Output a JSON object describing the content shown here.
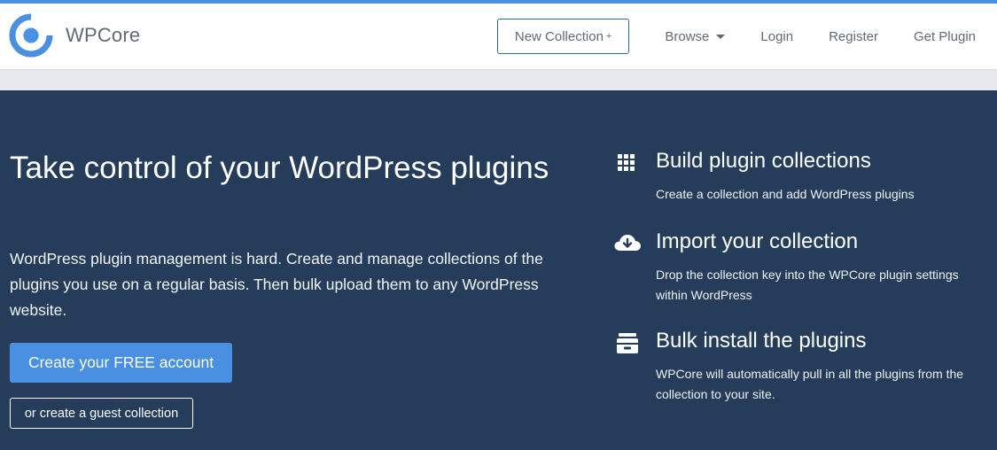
{
  "brand": {
    "name": "WPCore",
    "logo_icon": "wpcore-ring-logo-icon"
  },
  "nav": {
    "new_collection": "New Collection",
    "new_collection_plus": "+",
    "browse": "Browse",
    "login": "Login",
    "register": "Register",
    "get_plugin": "Get Plugin"
  },
  "hero": {
    "title": "Take control of your WordPress plugins",
    "description": "WordPress plugin management is hard. Create and manage collections of the plugins you use on a regular basis. Then bulk upload them to any WordPress website.",
    "cta_primary": "Create your FREE account",
    "cta_secondary": "or create a guest collection"
  },
  "features": [
    {
      "icon": "grid-icon",
      "title": "Build plugin collections",
      "text": "Create a collection and add WordPress plugins"
    },
    {
      "icon": "cloud-download-icon",
      "title": "Import your collection",
      "text": "Drop the collection key into the WPCore plugin settings within WordPress"
    },
    {
      "icon": "archive-icon",
      "title": "Bulk install the plugins",
      "text": "WPCore will automatically pull in all the plugins from the collection to your site."
    }
  ],
  "colors": {
    "accent": "#4a90e2",
    "hero_bg": "#253d5b",
    "nav_text": "#5f6b76",
    "page_bg": "#e6e9ed"
  }
}
